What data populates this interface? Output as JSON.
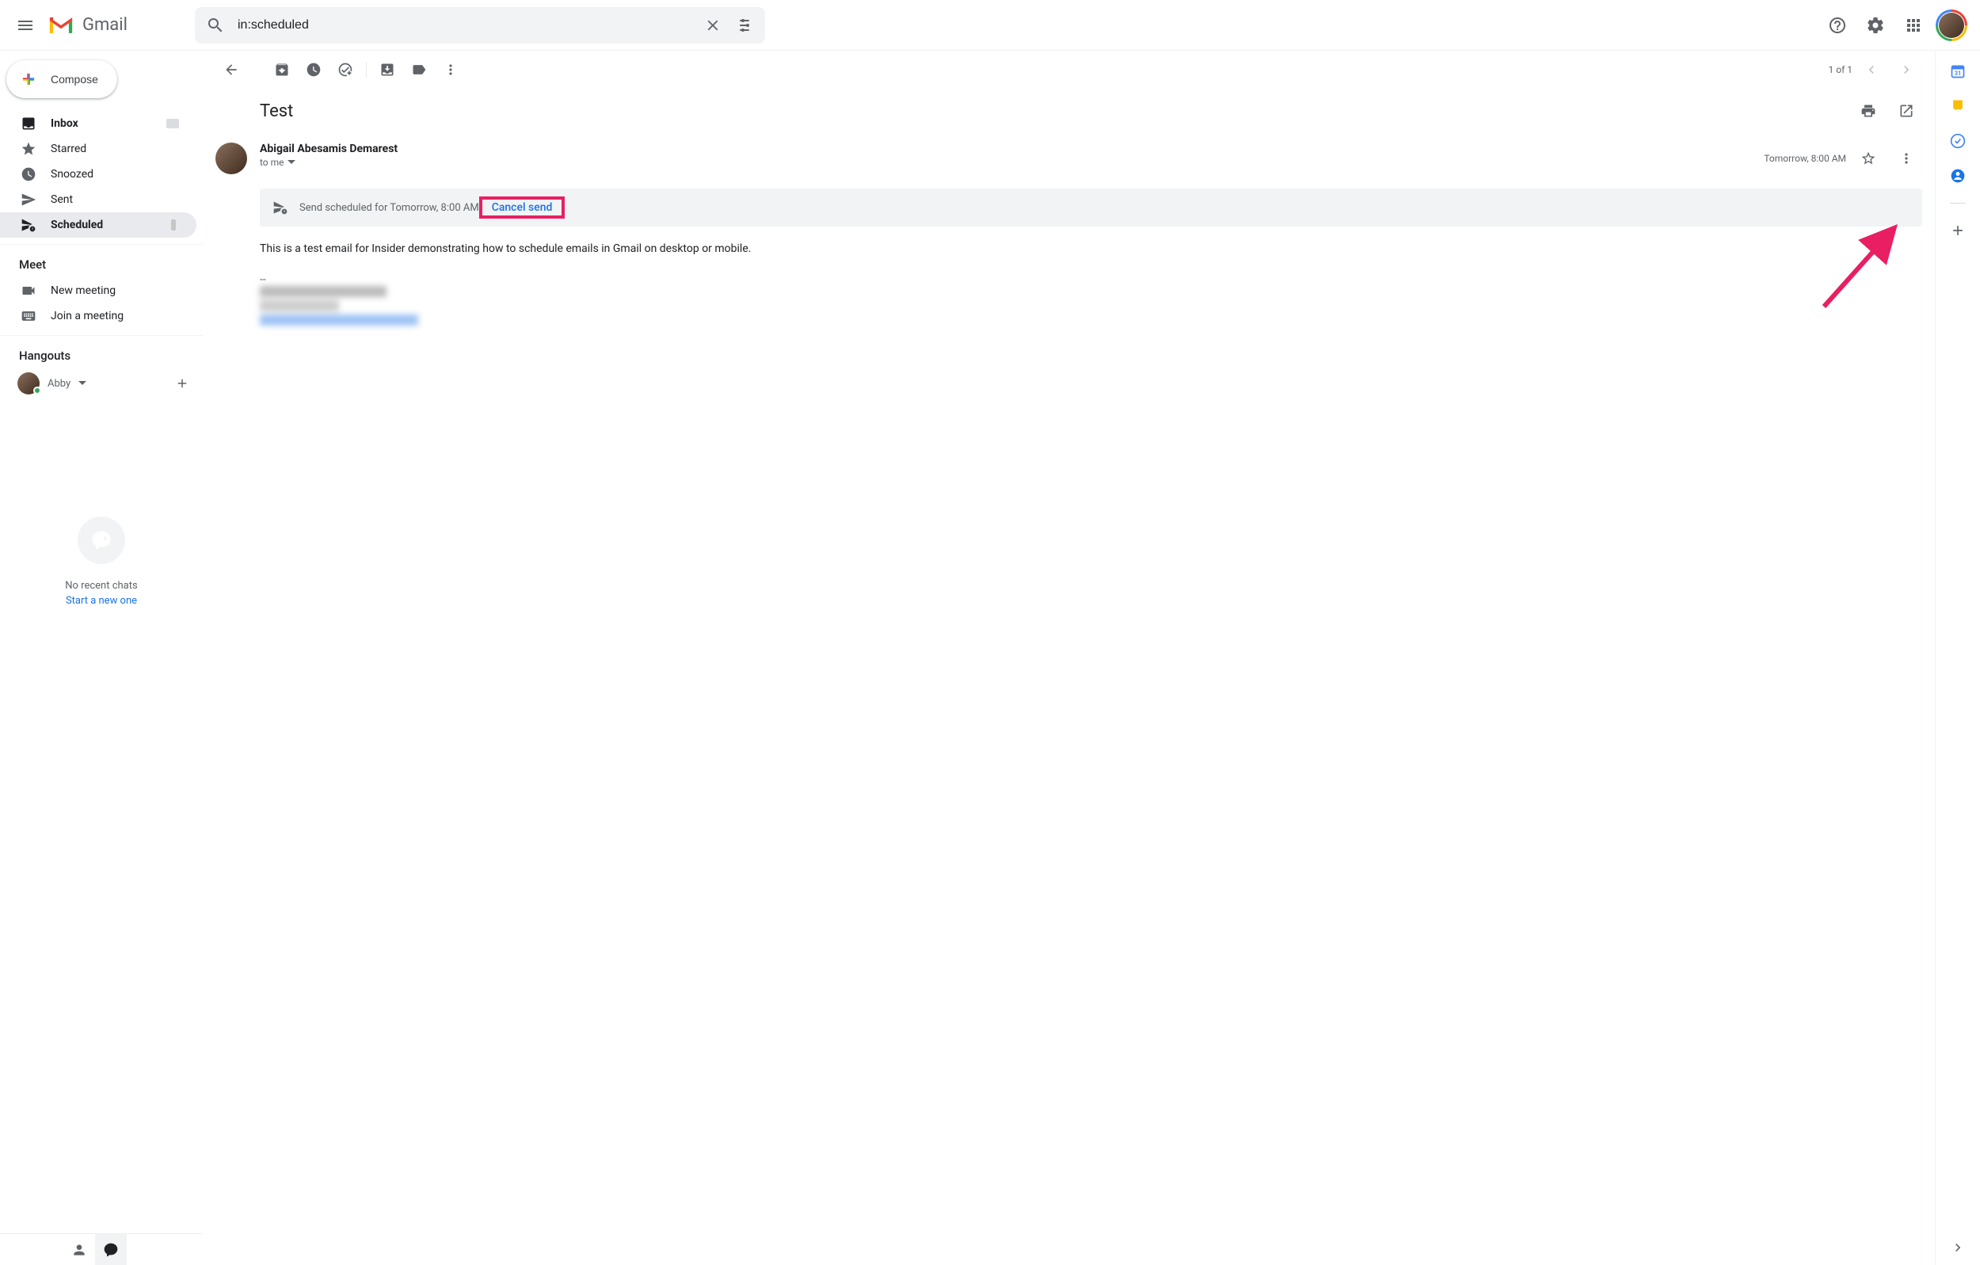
{
  "header": {
    "app_name": "Gmail",
    "search_value": "in:scheduled"
  },
  "compose_label": "Compose",
  "nav": {
    "inbox": "Inbox",
    "starred": "Starred",
    "snoozed": "Snoozed",
    "sent": "Sent",
    "scheduled": "Scheduled"
  },
  "meet": {
    "heading": "Meet",
    "new_meeting": "New meeting",
    "join_meeting": "Join a meeting"
  },
  "hangouts": {
    "heading": "Hangouts",
    "user_name": "Abby",
    "no_recent": "No recent chats",
    "start_new": "Start a new one"
  },
  "toolbar": {
    "counter": "1 of 1"
  },
  "email": {
    "subject": "Test",
    "from_name": "Abigail Abesamis Demarest",
    "to_text": "to me",
    "timestamp": "Tomorrow, 8:00 AM",
    "scheduled_text": "Send scheduled for Tomorrow, 8:00 AM",
    "cancel_send": "Cancel send",
    "body": "This is a test email for Insider demonstrating how to schedule emails in Gmail on desktop or mobile."
  }
}
